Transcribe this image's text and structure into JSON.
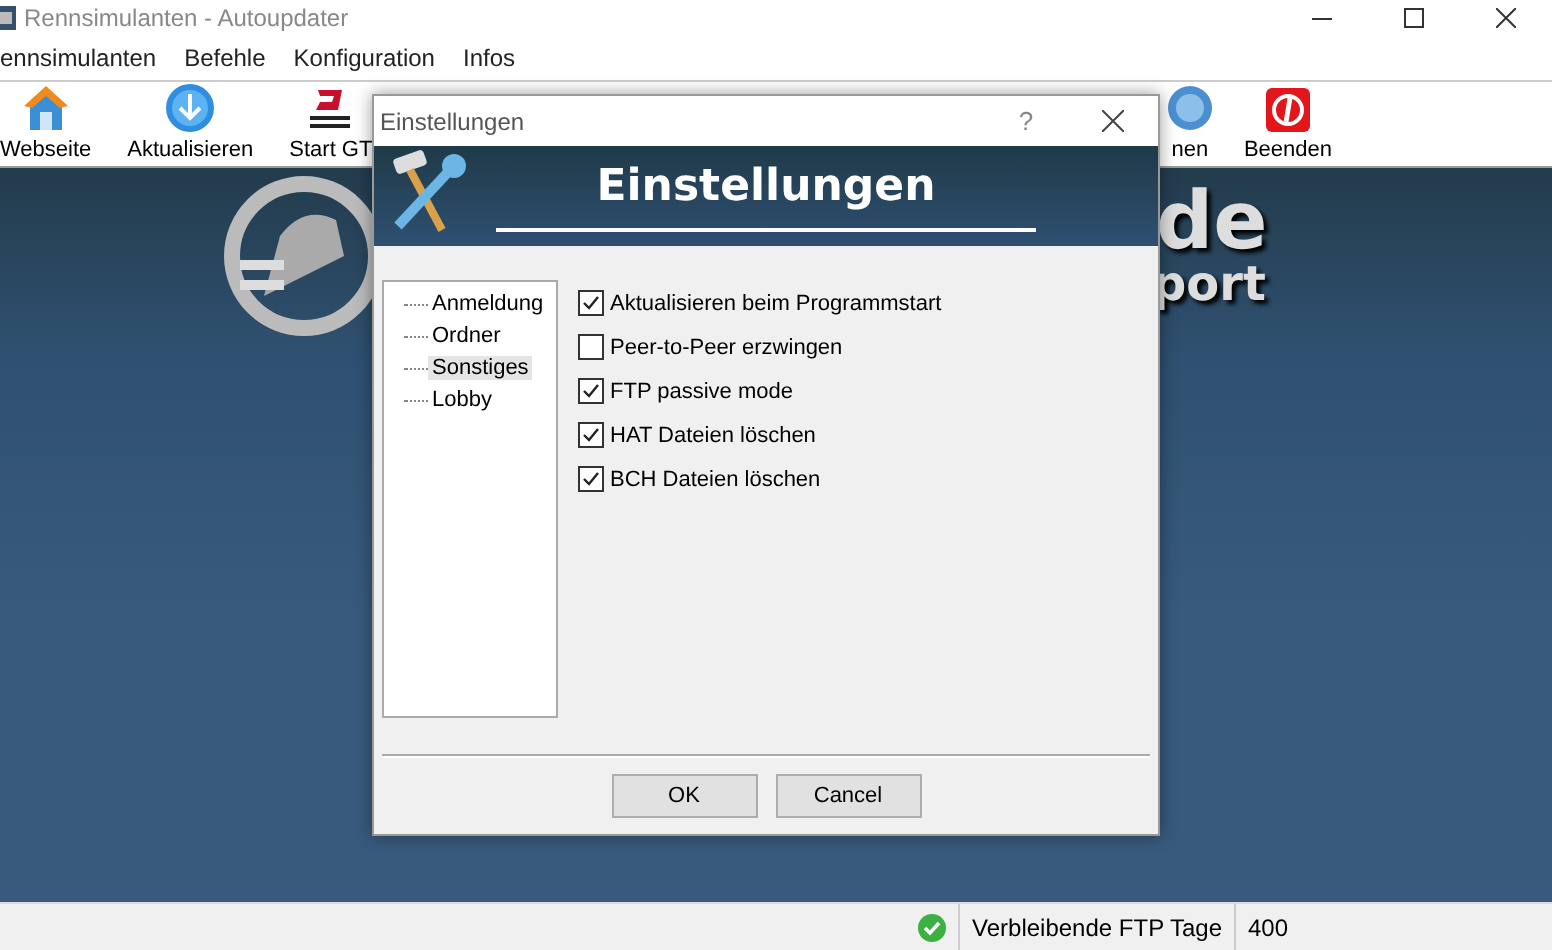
{
  "window": {
    "title": "Rennsimulanten - Autoupdater"
  },
  "menu": [
    "ennsimulanten",
    "Befehle",
    "Konfiguration",
    "Infos"
  ],
  "toolbar": [
    {
      "label": "Webseite",
      "kind": "house"
    },
    {
      "label": "Aktualisieren",
      "kind": "download"
    },
    {
      "label": "Start GT",
      "kind": "game"
    },
    {
      "label": "nen",
      "kind": "globe"
    },
    {
      "label": "Beenden",
      "kind": "power"
    }
  ],
  "background_logo": {
    "text_1": "de",
    "text_2": "port"
  },
  "dialog": {
    "title": "Einstellungen",
    "help": "?",
    "heading": "Einstellungen",
    "tree": [
      {
        "label": "Anmeldung",
        "selected": false
      },
      {
        "label": "Ordner",
        "selected": false
      },
      {
        "label": "Sonstiges",
        "selected": true
      },
      {
        "label": "Lobby",
        "selected": false
      }
    ],
    "options": [
      {
        "label": "Aktualisieren beim Programmstart",
        "checked": true
      },
      {
        "label": "Peer-to-Peer erzwingen",
        "checked": false
      },
      {
        "label": "FTP passive mode",
        "checked": true
      },
      {
        "label": "HAT Dateien löschen",
        "checked": true
      },
      {
        "label": "BCH Dateien löschen",
        "checked": true
      }
    ],
    "buttons": [
      "OK",
      "Cancel"
    ]
  },
  "status_bar": {
    "label": "Verbleibende FTP Tage",
    "value": "400"
  }
}
